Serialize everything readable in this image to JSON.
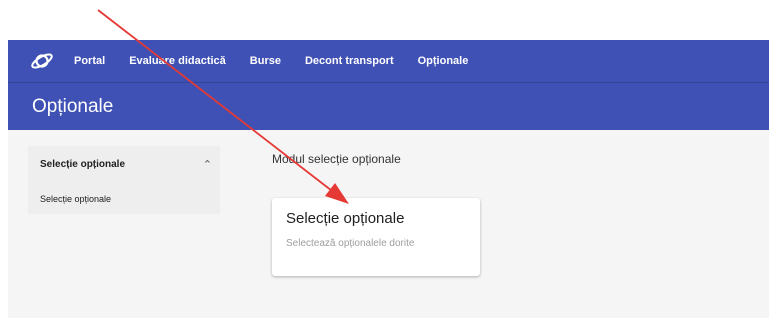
{
  "nav": {
    "links": [
      "Portal",
      "Evaluare didactică",
      "Burse",
      "Decont transport",
      "Opționale"
    ]
  },
  "page": {
    "title": "Opționale"
  },
  "sidebar": {
    "header": "Selecție opționale",
    "items": [
      "Selecție opționale"
    ]
  },
  "main": {
    "module_label": "Modul selecție opționale",
    "card": {
      "title": "Selecție opționale",
      "subtitle": "Selectează opționalele dorite"
    }
  },
  "colors": {
    "primary": "#3f51b5",
    "annotation_arrow": "#e53935"
  }
}
